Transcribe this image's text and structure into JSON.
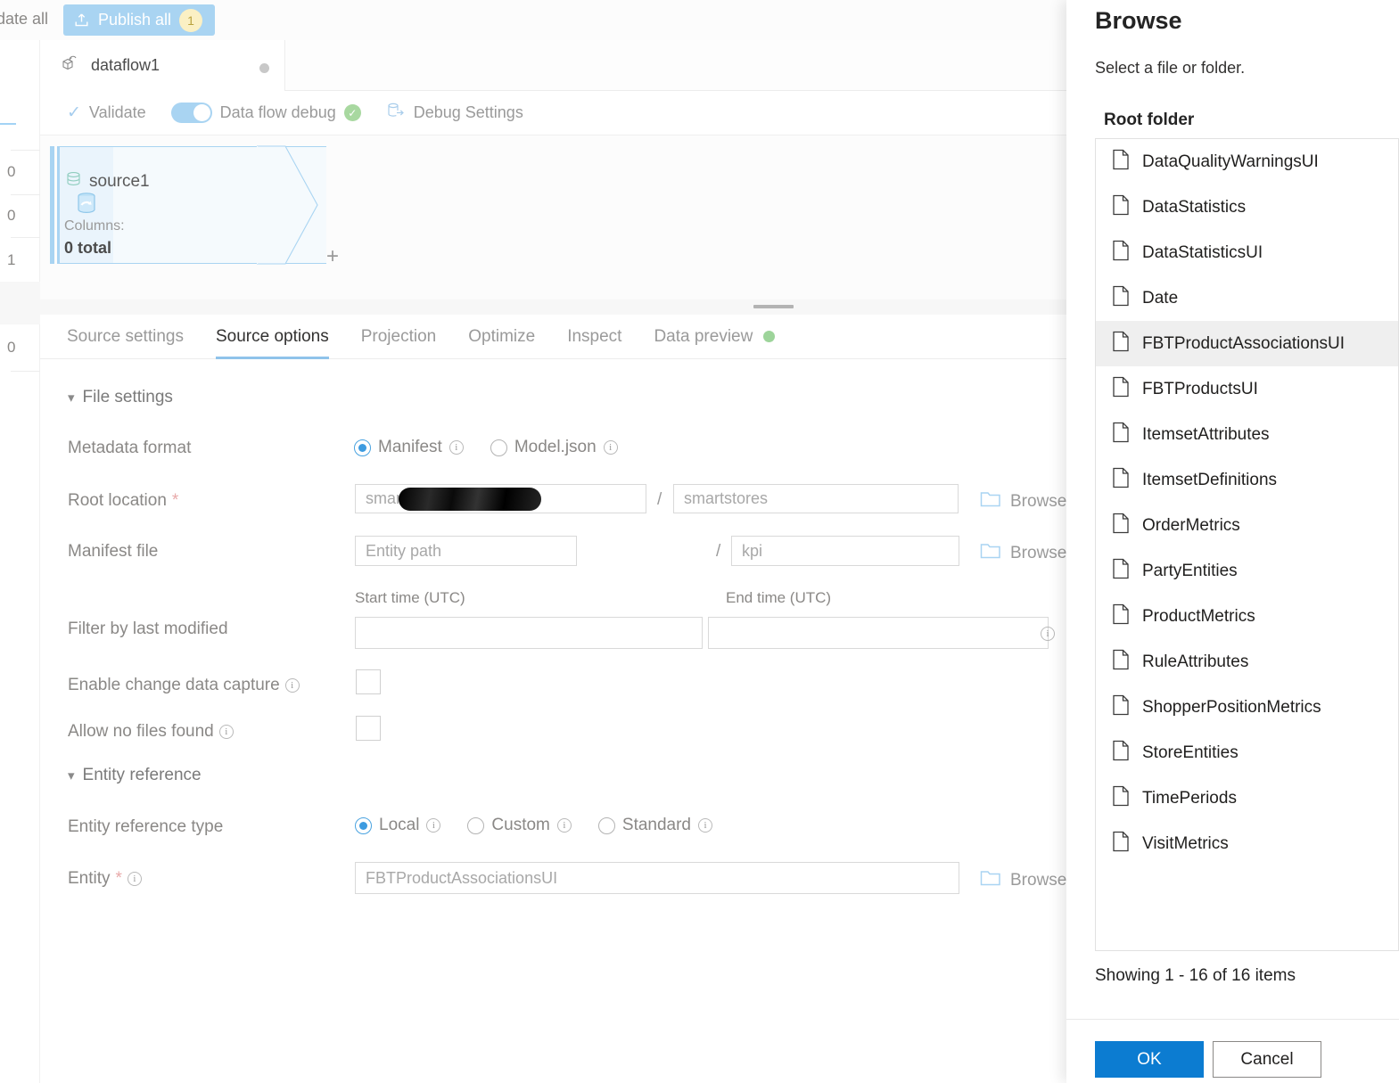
{
  "topbar": {
    "validate_all_label": "date all",
    "publish_all_label": "Publish all",
    "publish_badge": "1",
    "publish_icon": "upload-icon"
  },
  "left_rail": {
    "numbers": [
      "0",
      "0",
      "1",
      "0"
    ]
  },
  "dataflow_tab": {
    "label": "dataflow1",
    "icon": "dataflow-icon",
    "modified_dot": "unsaved-indicator"
  },
  "debug_toolbar": {
    "validate_label": "Validate",
    "validate_icon": "checkmark-icon",
    "data_flow_debug_label": "Data flow debug",
    "data_flow_debug_on": true,
    "debug_status_icon": "success-check-icon",
    "debug_settings_label": "Debug Settings",
    "debug_settings_icon": "database-export-icon"
  },
  "canvas": {
    "node": {
      "name": "source1",
      "icon": "source-database-icon",
      "columns_label": "Columns:",
      "columns_value": "0 total",
      "add_label": "+"
    }
  },
  "detail_tabs": {
    "items": [
      {
        "label": "Source settings",
        "active": false
      },
      {
        "label": "Source options",
        "active": true
      },
      {
        "label": "Projection",
        "active": false
      },
      {
        "label": "Optimize",
        "active": false
      },
      {
        "label": "Inspect",
        "active": false
      },
      {
        "label": "Data preview",
        "active": false,
        "status_dot": "#9dd49a"
      }
    ]
  },
  "source_options": {
    "file_settings": {
      "section_label": "File settings",
      "metadata_format": {
        "label": "Metadata format",
        "options": [
          {
            "label": "Manifest",
            "selected": true
          },
          {
            "label": "Model.json",
            "selected": false
          }
        ]
      },
      "root_location": {
        "label": "Root location",
        "required": "*",
        "container_value": "smar",
        "container_redacted": true,
        "separator": "/",
        "folder_value": "smartstores",
        "browse_label": "Browse",
        "browse_icon": "folder-icon"
      },
      "manifest_file": {
        "label": "Manifest file",
        "entity_path_placeholder": "Entity path",
        "separator": "/",
        "manifest_value": "kpi",
        "browse_label": "Browse",
        "browse_icon": "folder-icon"
      },
      "filter_by_last_modified": {
        "label": "Filter by last modified",
        "start_time_header": "Start time (UTC)",
        "end_time_header": "End time (UTC)",
        "start_time_value": "",
        "end_time_value": ""
      },
      "enable_change_data_capture": {
        "label": "Enable change data capture",
        "checked": false
      },
      "allow_no_files_found": {
        "label": "Allow no files found",
        "checked": false
      }
    },
    "entity_reference": {
      "section_label": "Entity reference",
      "entity_reference_type": {
        "label": "Entity reference type",
        "options": [
          {
            "label": "Local",
            "selected": true
          },
          {
            "label": "Custom",
            "selected": false
          },
          {
            "label": "Standard",
            "selected": false
          }
        ]
      },
      "entity": {
        "label": "Entity",
        "required": "*",
        "value": "FBTProductAssociationsUI",
        "browse_label": "Browse",
        "browse_icon": "folder-icon"
      }
    }
  },
  "browse_panel": {
    "title": "Browse",
    "subtitle": "Select a file or folder.",
    "section_label": "Root folder",
    "items": [
      {
        "label": "DataQualityWarningsUI",
        "selected": false
      },
      {
        "label": "DataStatistics",
        "selected": false
      },
      {
        "label": "DataStatisticsUI",
        "selected": false
      },
      {
        "label": "Date",
        "selected": false
      },
      {
        "label": "FBTProductAssociationsUI",
        "selected": true
      },
      {
        "label": "FBTProductsUI",
        "selected": false
      },
      {
        "label": "ItemsetAttributes",
        "selected": false
      },
      {
        "label": "ItemsetDefinitions",
        "selected": false
      },
      {
        "label": "OrderMetrics",
        "selected": false
      },
      {
        "label": "PartyEntities",
        "selected": false
      },
      {
        "label": "ProductMetrics",
        "selected": false
      },
      {
        "label": "RuleAttributes",
        "selected": false
      },
      {
        "label": "ShopperPositionMetrics",
        "selected": false
      },
      {
        "label": "StoreEntities",
        "selected": false
      },
      {
        "label": "TimePeriods",
        "selected": false
      },
      {
        "label": "VisitMetrics",
        "selected": false
      }
    ],
    "showing_text": "Showing 1 - 16 of 16 items",
    "ok_label": "OK",
    "cancel_label": "Cancel",
    "accent_color": "#0c7cd1"
  }
}
